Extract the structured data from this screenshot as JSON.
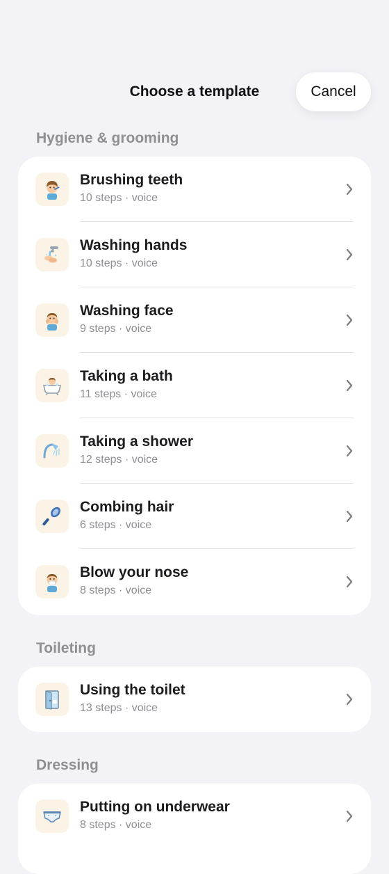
{
  "header": {
    "title": "Choose a template",
    "cancel_label": "Cancel"
  },
  "sections": [
    {
      "title": "Hygiene & grooming",
      "items": [
        {
          "title": "Brushing teeth",
          "subtitle": "10 steps · voice",
          "icon": "child-brushing-teeth-icon"
        },
        {
          "title": "Washing hands",
          "subtitle": "10 steps · voice",
          "icon": "faucet-hands-icon"
        },
        {
          "title": "Washing face",
          "subtitle": "9 steps · voice",
          "icon": "child-washing-face-icon"
        },
        {
          "title": "Taking a bath",
          "subtitle": "11 steps · voice",
          "icon": "bathtub-icon"
        },
        {
          "title": "Taking a shower",
          "subtitle": "12 steps · voice",
          "icon": "shower-head-icon"
        },
        {
          "title": "Combing hair",
          "subtitle": "6 steps · voice",
          "icon": "hairbrush-icon"
        },
        {
          "title": "Blow your nose",
          "subtitle": "8 steps · voice",
          "icon": "child-blowing-nose-icon"
        }
      ]
    },
    {
      "title": "Toileting",
      "items": [
        {
          "title": "Using the toilet",
          "subtitle": "13 steps · voice",
          "icon": "bathroom-door-icon"
        }
      ]
    },
    {
      "title": "Dressing",
      "items": [
        {
          "title": "Putting on underwear",
          "subtitle": "8 steps · voice",
          "icon": "underwear-icon"
        }
      ]
    }
  ]
}
